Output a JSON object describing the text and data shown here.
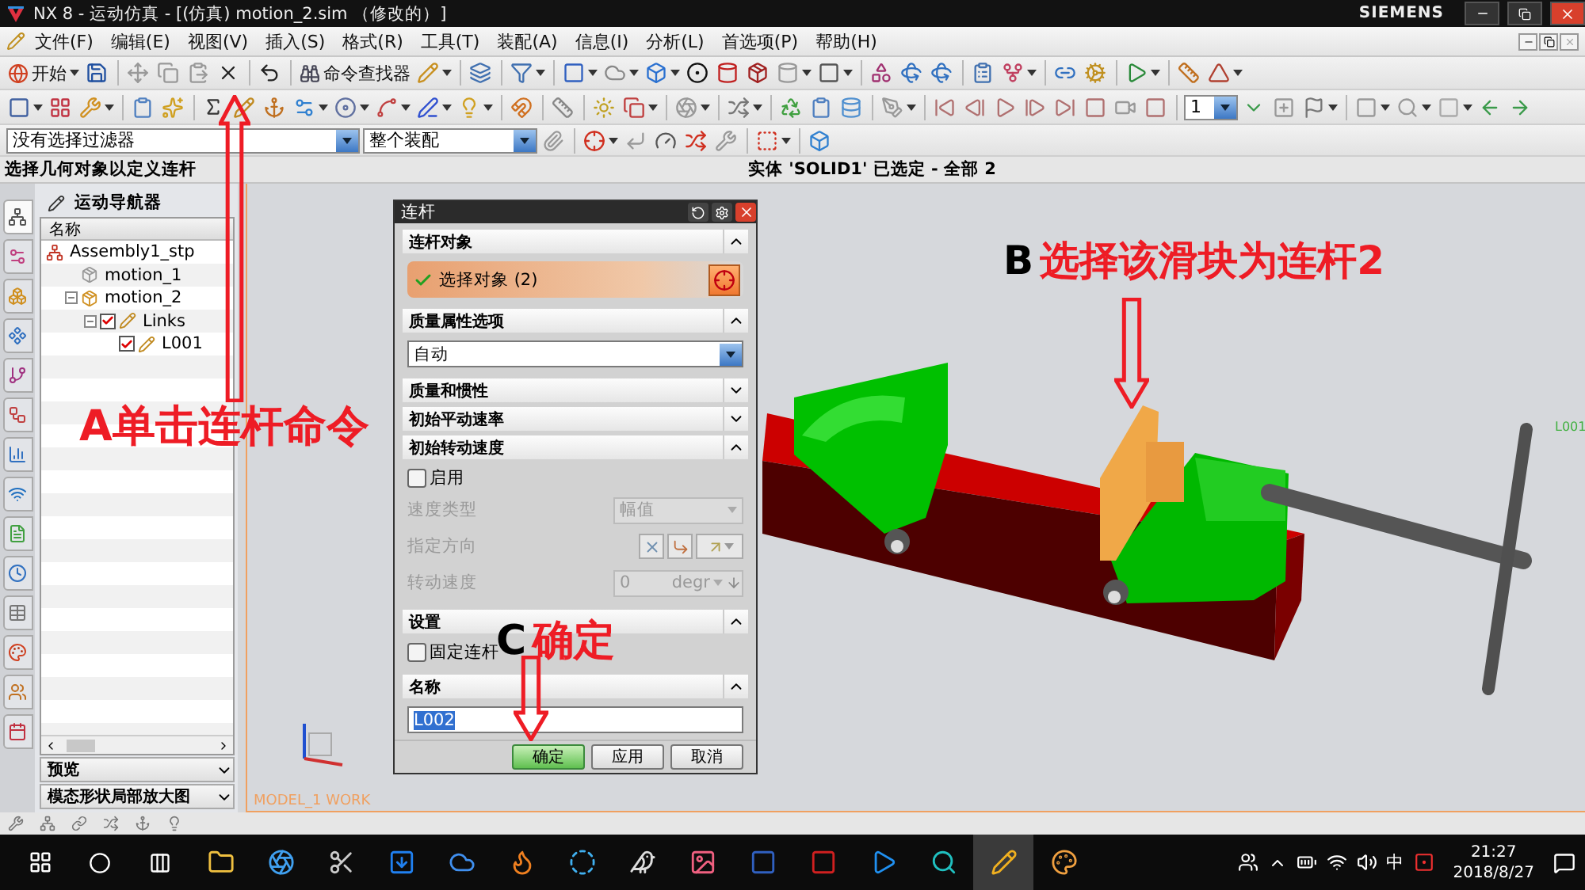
{
  "window": {
    "title": "NX 8 - 运动仿真 - [(仿真) motion_2.sim （修改的）]",
    "brand": "SIEMENS"
  },
  "menu": [
    "文件(F)",
    "编辑(E)",
    "视图(V)",
    "插入(S)",
    "格式(R)",
    "工具(T)",
    "装配(A)",
    "信息(I)",
    "分析(L)",
    "首选项(P)",
    "帮助(H)"
  ],
  "toolbar": {
    "start": "开始",
    "command_finder": "命令查找器",
    "frame_value": "1"
  },
  "selection_bar": {
    "filter": "没有选择过滤器",
    "scope": "整个装配"
  },
  "cue_line": {
    "prompt": "选择几何对象以定义连杆",
    "status": "实体 'SOLID1' 已选定 - 全部 2"
  },
  "navigator": {
    "title": "运动导航器",
    "column": "名称",
    "tree": [
      {
        "label": "Assembly1_stp",
        "kind": "assembly",
        "children": [
          {
            "label": "motion_1",
            "kind": "simulation",
            "active": false
          },
          {
            "label": "motion_2",
            "kind": "simulation",
            "active": true,
            "expanded": true,
            "children": [
              {
                "label": "Links",
                "kind": "link",
                "checked": true,
                "expanded": true,
                "children": [
                  {
                    "label": "L001",
                    "kind": "link",
                    "checked": true
                  }
                ]
              }
            ]
          }
        ]
      }
    ],
    "panels": [
      "预览",
      "模态形状局部放大图"
    ],
    "tabs": [
      {
        "selected": true
      },
      {
        "selected": false
      },
      {
        "selected": false
      },
      {
        "selected": false
      },
      {
        "selected": false
      },
      {
        "selected": false
      },
      {
        "selected": false
      },
      {
        "selected": false
      },
      {
        "selected": false
      },
      {
        "selected": false
      },
      {
        "selected": false
      },
      {
        "selected": false
      },
      {
        "selected": false
      },
      {
        "selected": false
      }
    ]
  },
  "dialog": {
    "title": "连杆",
    "sections": [
      {
        "title": "连杆对象",
        "expanded": true,
        "kind": "selection",
        "label": "选择对象 (2)",
        "done": true
      },
      {
        "title": "质量属性选项",
        "expanded": true,
        "kind": "dropdown",
        "value": "自动"
      },
      {
        "title": "质量和惯性",
        "expanded": false
      },
      {
        "title": "初始平动速率",
        "expanded": false
      },
      {
        "title": "初始转动速度",
        "expanded": true,
        "kind": "velocity",
        "enable": {
          "label": "启用",
          "checked": false
        },
        "rows": [
          {
            "label": "速度类型",
            "kind": "select",
            "value": "幅值",
            "disabled": true
          },
          {
            "label": "指定方向",
            "kind": "vector",
            "disabled": true
          },
          {
            "label": "转动速度",
            "kind": "number",
            "value": "0",
            "unit": "degr",
            "disabled": true
          }
        ]
      },
      {
        "title": "设置",
        "expanded": true,
        "kind": "checkbox",
        "label": "固定连杆",
        "checked": false
      },
      {
        "title": "名称",
        "expanded": true,
        "kind": "text",
        "value": "L002",
        "value_selected": true
      }
    ],
    "buttons": [
      {
        "label": "确定",
        "default": true
      },
      {
        "label": "应用",
        "default": false
      },
      {
        "label": "取消",
        "default": false
      }
    ]
  },
  "viewport": {
    "link_label": "L001",
    "view_label": "MODEL_1 WORK"
  },
  "annotations": [
    {
      "letter": "A",
      "text": "单击连杆命令",
      "kind": "up"
    },
    {
      "letter": "B",
      "text": "选择该滑块为连杆2",
      "kind": "down"
    },
    {
      "letter": "C",
      "text": "确定",
      "kind": "down"
    }
  ],
  "taskbar": {
    "input_method": "中",
    "time": "21:27",
    "date": "2018/8/27"
  }
}
